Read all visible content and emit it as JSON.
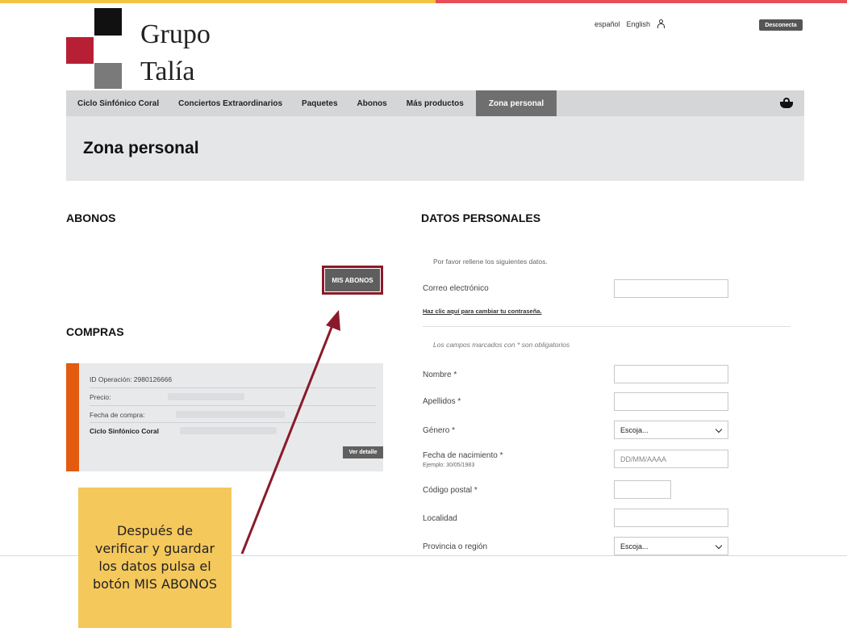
{
  "header": {
    "logo_line1": "Grupo",
    "logo_line2": "Talía",
    "lang_es": "español",
    "lang_en": "English",
    "disconnect": "Desconecta"
  },
  "nav": {
    "items": [
      "Ciclo Sinfónico Coral",
      "Conciertos Extraordinarios",
      "Paquetes",
      "Abonos",
      "Más productos"
    ],
    "active": "Zona personal"
  },
  "page_title": "Zona personal",
  "abonos": {
    "title": "ABONOS",
    "button": "MIS ABONOS"
  },
  "compras": {
    "title": "COMPRAS",
    "operation_id": "ID Operación: 2980126666",
    "price_label": "Precio:",
    "date_label": "Fecha de compra:",
    "product": "Ciclo Sinfónico Coral",
    "detail_button": "Ver detalle"
  },
  "datos": {
    "title": "DATOS PERSONALES",
    "intro": "Por favor rellene los siguientes datos.",
    "email_label": "Correo electrónico",
    "change_password": "Haz clic aquí para cambiar tu contraseña.",
    "required_note": "Los campos marcados con * son obligatorios",
    "nombre": "Nombre *",
    "apellidos": "Apellidos *",
    "genero": "Género *",
    "genero_value": "Escoja...",
    "fecha": "Fecha de nacimiento *",
    "fecha_example": "Ejemplo: 30/05/1983",
    "fecha_placeholder": "DD/MM/AAAA",
    "cp": "Código postal *",
    "localidad": "Localidad",
    "provincia": "Provincia o región",
    "provincia_value": "Escoja..."
  },
  "annotation": {
    "text": "Después de verificar y guardar los datos pulsa el botón MIS ABONOS"
  },
  "colors": {
    "accent_orange": "#e35b10",
    "highlight_red": "#8a1a2a",
    "note_yellow": "#f5c85c"
  }
}
